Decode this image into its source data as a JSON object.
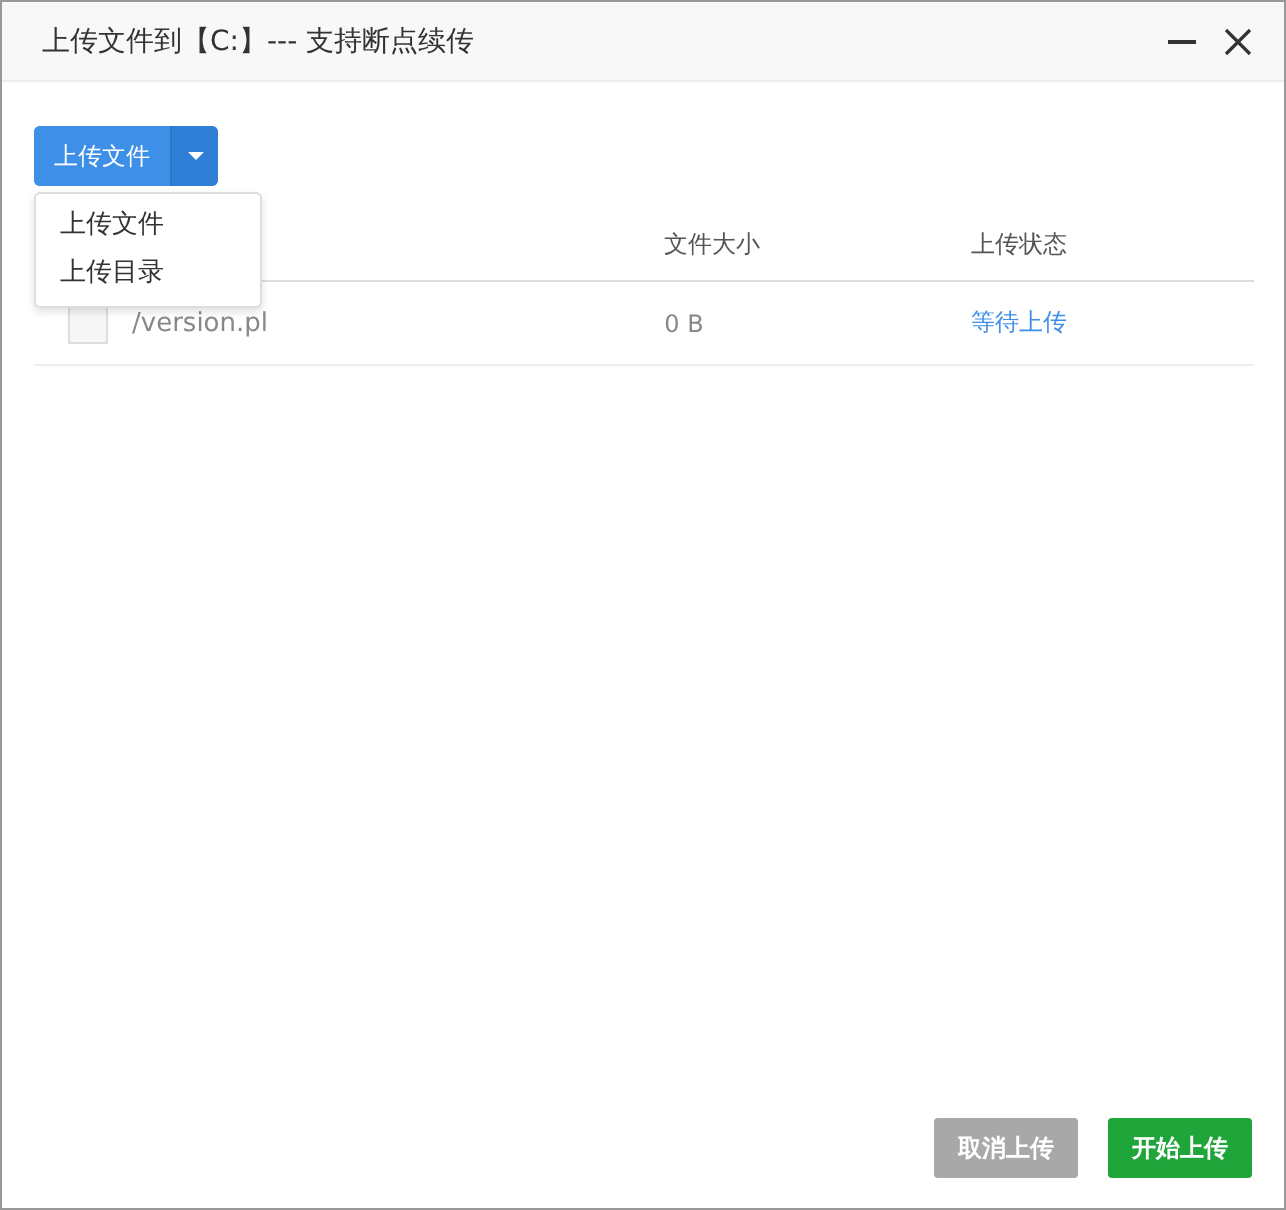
{
  "window": {
    "title": "上传文件到【C:】--- 支持断点续传"
  },
  "upload_button": {
    "label": "上传文件"
  },
  "dropdown_menu": {
    "expanded": true,
    "items": [
      {
        "label": "上传文件"
      },
      {
        "label": "上传目录"
      }
    ]
  },
  "table": {
    "columns": [
      "",
      "文件大小",
      "上传状态"
    ],
    "rows": [
      {
        "checked": false,
        "name": "/version.pl",
        "size": "0 B",
        "status": "等待上传"
      }
    ]
  },
  "buttons": [
    {
      "label": "取消上传",
      "kind": "cancel",
      "disabled": true
    },
    {
      "label": "开始上传",
      "kind": "start",
      "disabled": false
    }
  ]
}
